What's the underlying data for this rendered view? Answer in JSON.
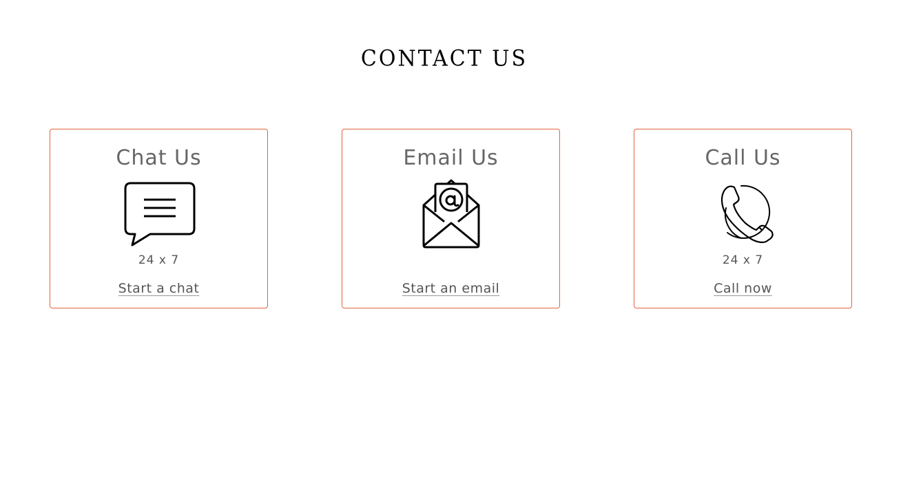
{
  "page": {
    "title": "CONTACT US"
  },
  "accent_color": "#e0633c",
  "cards": [
    {
      "title": "Chat Us",
      "icon": "chat-bubble-icon",
      "availability": "24 x 7",
      "link_label": "Start a chat"
    },
    {
      "title": "Email Us",
      "icon": "open-envelope-at-icon",
      "availability": "",
      "link_label": "Start an email"
    },
    {
      "title": "Call Us",
      "icon": "phone-handset-icon",
      "availability": "24 x 7",
      "link_label": "Call now"
    }
  ]
}
